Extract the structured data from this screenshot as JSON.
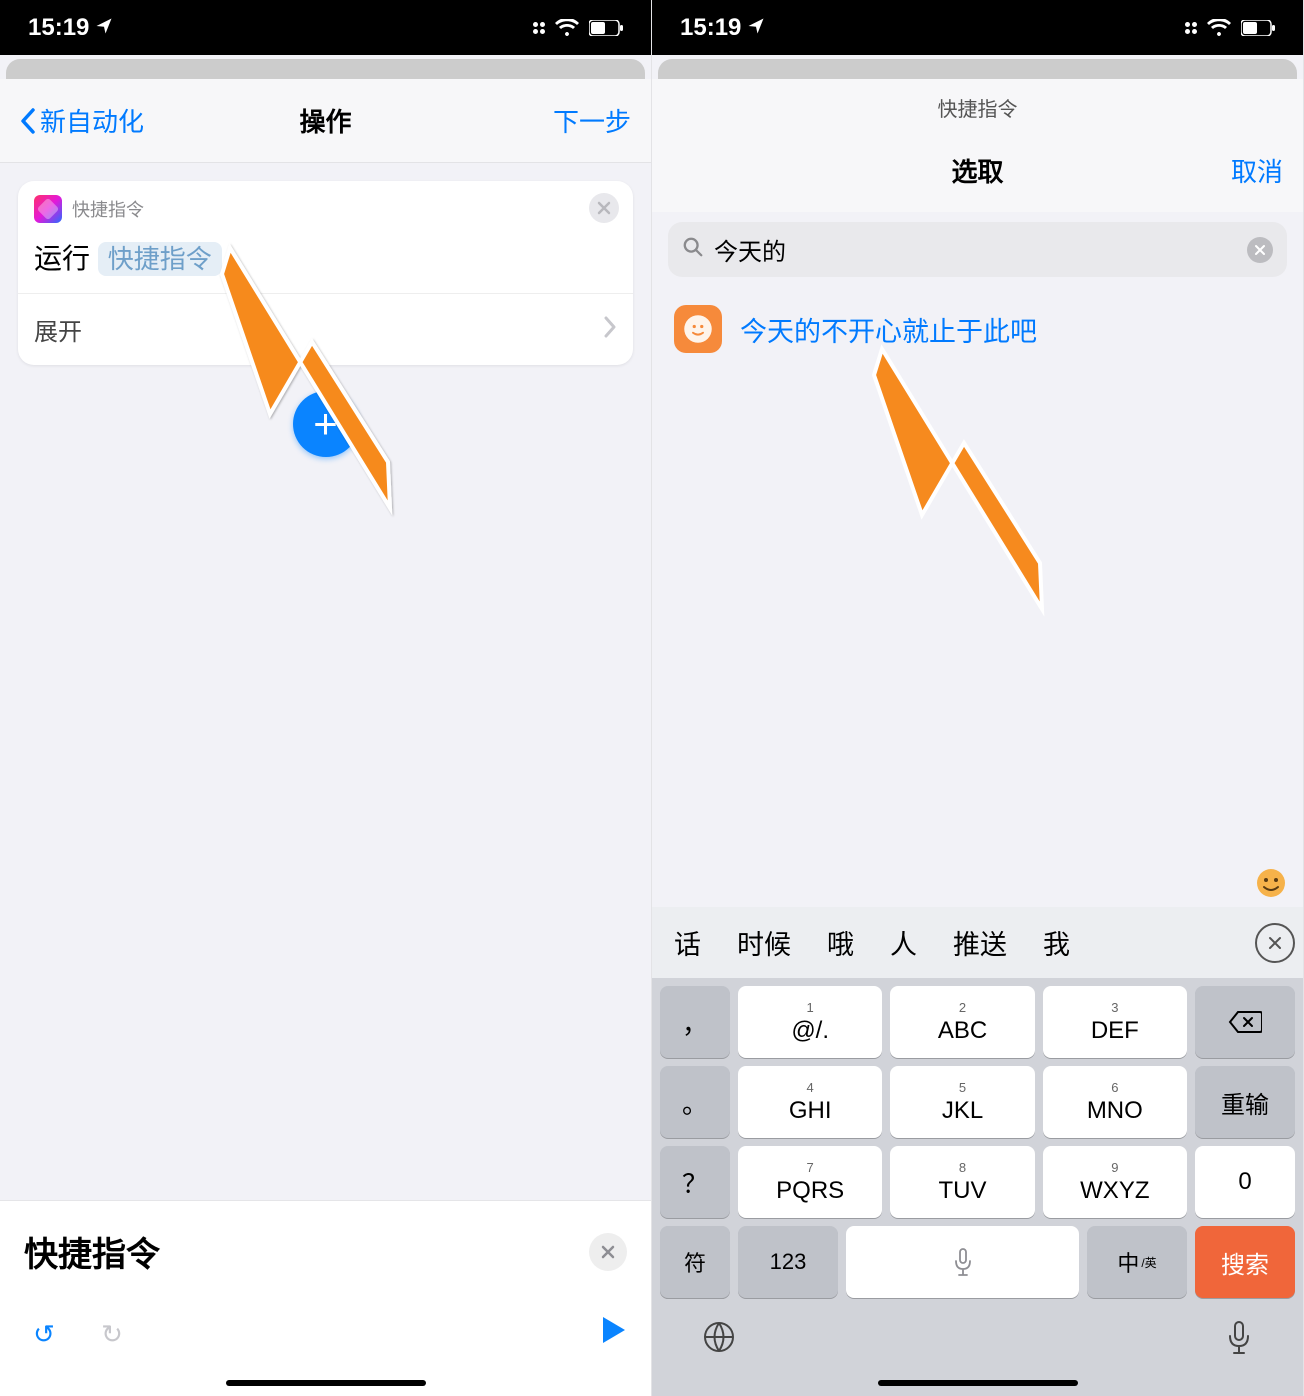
{
  "status": {
    "time": "15:19"
  },
  "left": {
    "nav": {
      "back": "新自动化",
      "title": "操作",
      "next": "下一步"
    },
    "card": {
      "app_label": "快捷指令",
      "run_label": "运行",
      "shortcut_placeholder": "快捷指令",
      "expand_label": "展开"
    },
    "bottom": {
      "title": "快捷指令"
    }
  },
  "right": {
    "mini_title": "快捷指令",
    "nav": {
      "title": "选取",
      "cancel": "取消"
    },
    "search": {
      "value": "今天的"
    },
    "result": {
      "label": "今天的不开心就止于此吧"
    },
    "candidates": [
      "话",
      "时候",
      "哦",
      "人",
      "推送",
      "我"
    ],
    "keys": {
      "row1": [
        {
          "n": "1",
          "l": "@/."
        },
        {
          "n": "2",
          "l": "ABC"
        },
        {
          "n": "3",
          "l": "DEF"
        }
      ],
      "row2": [
        {
          "n": "4",
          "l": "GHI"
        },
        {
          "n": "5",
          "l": "JKL"
        },
        {
          "n": "6",
          "l": "MNO"
        }
      ],
      "row3": [
        {
          "n": "7",
          "l": "PQRS"
        },
        {
          "n": "8",
          "l": "TUV"
        },
        {
          "n": "9",
          "l": "WXYZ"
        }
      ],
      "left": [
        "，",
        "。",
        "？",
        "！"
      ],
      "right_retype": "重输",
      "right_zero": "0",
      "bottom": {
        "sym": "符",
        "num": "123",
        "lang": "中",
        "lang_sub": "/英",
        "search": "搜索"
      }
    }
  }
}
